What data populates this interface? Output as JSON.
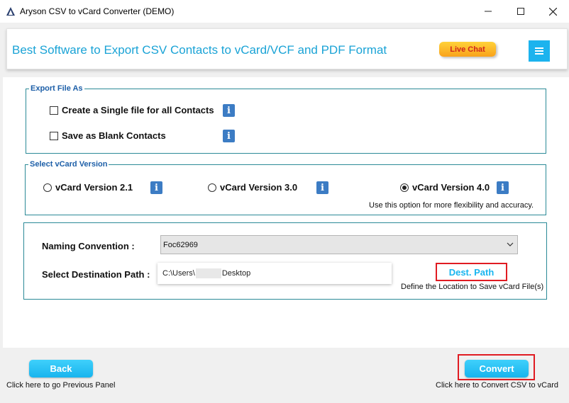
{
  "window": {
    "title": "Aryson CSV to vCard Converter (DEMO)"
  },
  "banner": {
    "headline": "Best Software to Export CSV Contacts to vCard/VCF and PDF Format",
    "live_chat_label": "Live Chat",
    "menu_icon": "hamburger-icon"
  },
  "export_group": {
    "legend": "Export File As",
    "options": [
      {
        "label": "Create a Single file for all Contacts",
        "checked": false
      },
      {
        "label": "Save as Blank Contacts",
        "checked": false
      }
    ],
    "info_glyph": "i"
  },
  "version_group": {
    "legend": "Select vCard Version",
    "options": [
      {
        "label": "vCard Version 2.1",
        "selected": false
      },
      {
        "label": "vCard Version 3.0",
        "selected": false
      },
      {
        "label": "vCard Version 4.0",
        "selected": true
      }
    ],
    "hint": "Use this option for more flexibility and accuracy."
  },
  "output_group": {
    "naming_label": "Naming Convention :",
    "naming_value": "Foc62969",
    "dest_label": "Select Destination Path :",
    "path_prefix": "C:\\Users\\",
    "path_suffix": "Desktop",
    "dest_button": "Dest. Path",
    "dest_hint": "Define the Location to Save vCard File(s)"
  },
  "footer": {
    "back_label": "Back",
    "back_hint": "Click here to go Previous Panel",
    "convert_label": "Convert",
    "convert_hint": "Click here to Convert CSV to vCard"
  },
  "colors": {
    "accent": "#1cb3ee",
    "headline": "#1aa3d6",
    "highlight_border": "#e01b22",
    "group_border": "#2b8a97",
    "legend": "#1d5fa8",
    "info": "#3c7cc4"
  }
}
